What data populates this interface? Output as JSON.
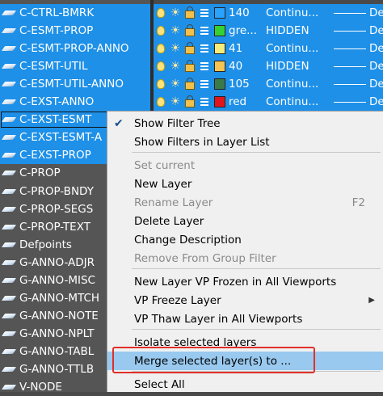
{
  "layers": [
    {
      "name": "C-CTRL-BMRK",
      "selected": true
    },
    {
      "name": "C-ESMT-PROP",
      "selected": true
    },
    {
      "name": "C-ESMT-PROP-ANNO",
      "selected": true
    },
    {
      "name": "C-ESMT-UTIL",
      "selected": true
    },
    {
      "name": "C-ESMT-UTIL-ANNO",
      "selected": true
    },
    {
      "name": "C-EXST-ANNO",
      "selected": true
    },
    {
      "name": "C-EXST-ESMT",
      "selected": true
    },
    {
      "name": "C-EXST-ESMT-A",
      "selected": true
    },
    {
      "name": "C-EXST-PROP",
      "selected": true
    },
    {
      "name": "C-PROP",
      "selected": false
    },
    {
      "name": "C-PROP-BNDY",
      "selected": false
    },
    {
      "name": "C-PROP-SEGS",
      "selected": false
    },
    {
      "name": "C-PROP-TEXT",
      "selected": false
    },
    {
      "name": "Defpoints",
      "selected": false
    },
    {
      "name": "G-ANNO-ADJR",
      "selected": false
    },
    {
      "name": "G-ANNO-MISC",
      "selected": false
    },
    {
      "name": "G-ANNO-MTCH",
      "selected": false
    },
    {
      "name": "G-ANNO-NOTE",
      "selected": false
    },
    {
      "name": "G-ANNO-NPLT",
      "selected": false
    },
    {
      "name": "G-ANNO-TABL",
      "selected": false
    },
    {
      "name": "G-ANNO-TTLB",
      "selected": false
    },
    {
      "name": "V-NODE",
      "selected": false
    }
  ],
  "layer_props": [
    {
      "color_hex": "#29a3ff",
      "color": "140",
      "linetype": "Continu...",
      "lineweight": "Defa"
    },
    {
      "color_hex": "#33d133",
      "color": "gre...",
      "linetype": "HIDDEN",
      "lineweight": "Defa"
    },
    {
      "color_hex": "#f4ec7a",
      "color": "41",
      "linetype": "Continu...",
      "lineweight": "Defa"
    },
    {
      "color_hex": "#f5c451",
      "color": "40",
      "linetype": "HIDDEN",
      "lineweight": "Defa"
    },
    {
      "color_hex": "#3a7a4a",
      "color": "105",
      "linetype": "Continu...",
      "lineweight": "Defa"
    },
    {
      "color_hex": "#e2151b",
      "color": "red",
      "linetype": "Continu...",
      "lineweight": "Defa"
    }
  ],
  "menu": {
    "items": [
      {
        "label": "Show Filter Tree",
        "checked": true,
        "disabled": false,
        "shortcut": "",
        "submenu": false,
        "highlighted": false
      },
      {
        "label": "Show Filters in Layer List",
        "checked": false,
        "disabled": false,
        "shortcut": "",
        "submenu": false,
        "highlighted": false
      },
      {
        "label": "Set current",
        "checked": false,
        "disabled": true,
        "shortcut": "",
        "submenu": false,
        "highlighted": false
      },
      {
        "label": "New Layer",
        "checked": false,
        "disabled": false,
        "shortcut": "",
        "submenu": false,
        "highlighted": false
      },
      {
        "label": "Rename Layer",
        "checked": false,
        "disabled": true,
        "shortcut": "F2",
        "submenu": false,
        "highlighted": false
      },
      {
        "label": "Delete Layer",
        "checked": false,
        "disabled": false,
        "shortcut": "",
        "submenu": false,
        "highlighted": false
      },
      {
        "label": "Change Description",
        "checked": false,
        "disabled": false,
        "shortcut": "",
        "submenu": false,
        "highlighted": false
      },
      {
        "label": "Remove From Group Filter",
        "checked": false,
        "disabled": true,
        "shortcut": "",
        "submenu": false,
        "highlighted": false
      },
      {
        "label": "New Layer VP Frozen in All Viewports",
        "checked": false,
        "disabled": false,
        "shortcut": "",
        "submenu": false,
        "highlighted": false
      },
      {
        "label": "VP Freeze Layer",
        "checked": false,
        "disabled": false,
        "shortcut": "",
        "submenu": true,
        "highlighted": false
      },
      {
        "label": "VP Thaw Layer in All Viewports",
        "checked": false,
        "disabled": false,
        "shortcut": "",
        "submenu": false,
        "highlighted": false
      },
      {
        "label": "Isolate selected layers",
        "checked": false,
        "disabled": false,
        "shortcut": "",
        "submenu": false,
        "highlighted": false
      },
      {
        "label": "Merge selected layer(s) to ...",
        "checked": false,
        "disabled": false,
        "shortcut": "",
        "submenu": false,
        "highlighted": true
      },
      {
        "label": "Select All",
        "checked": false,
        "disabled": false,
        "shortcut": "",
        "submenu": false,
        "highlighted": false
      }
    ]
  },
  "colors": {
    "selection": "#1e90e8",
    "menu_highlight": "#99c9ef",
    "annotation_box": "#e0302a"
  }
}
